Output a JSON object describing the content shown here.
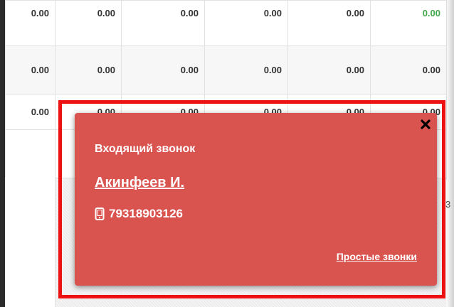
{
  "table": {
    "rows": [
      [
        "0.00",
        "0.00",
        "0.00",
        "0.00",
        "0.00",
        "0.00"
      ],
      [
        "0.00",
        "0.00",
        "0.00",
        "0.00",
        "0.00",
        "0.00"
      ],
      [
        "0.00",
        "0.00",
        "0.00",
        "0.00",
        "0.00",
        "0.00"
      ]
    ],
    "peek_value": "3"
  },
  "notification": {
    "title": "Входящий звонок",
    "caller_name": "Акинфеев И.",
    "phone_number": "79318903126",
    "link_label": "Простые звонки",
    "close_icon": "close-icon",
    "phone_icon": "mobile-phone-icon",
    "background_color": "#d9534f"
  },
  "colors": {
    "highlight_frame": "#ee1111",
    "positive_value": "#43a84a"
  }
}
